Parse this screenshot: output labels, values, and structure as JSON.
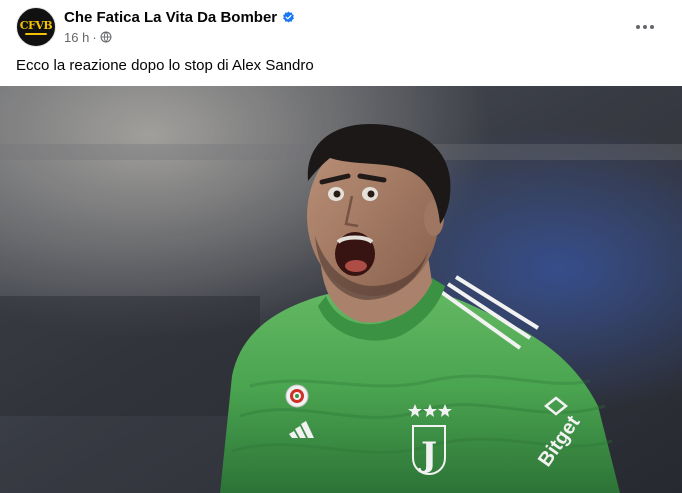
{
  "post": {
    "page_name": "Che Fatica La Vita Da Bomber",
    "avatar_text": "CFVB",
    "timestamp": "16 h",
    "separator": "·",
    "audience_icon": "globe-icon",
    "verified_icon": "verified-badge-icon",
    "more_icon": "more-options-icon",
    "caption": "Ecco la reazione dopo lo stop di Alex Sandro",
    "photo": {
      "kit_colors": [
        "#4fae55",
        "#2f7a3a",
        "#ffffff"
      ],
      "sponsor_text": "Bitget",
      "crest_text": "J"
    }
  },
  "colors": {
    "accent": "#1877f2",
    "secondary_text": "#65676b",
    "primary_text": "#050505"
  }
}
